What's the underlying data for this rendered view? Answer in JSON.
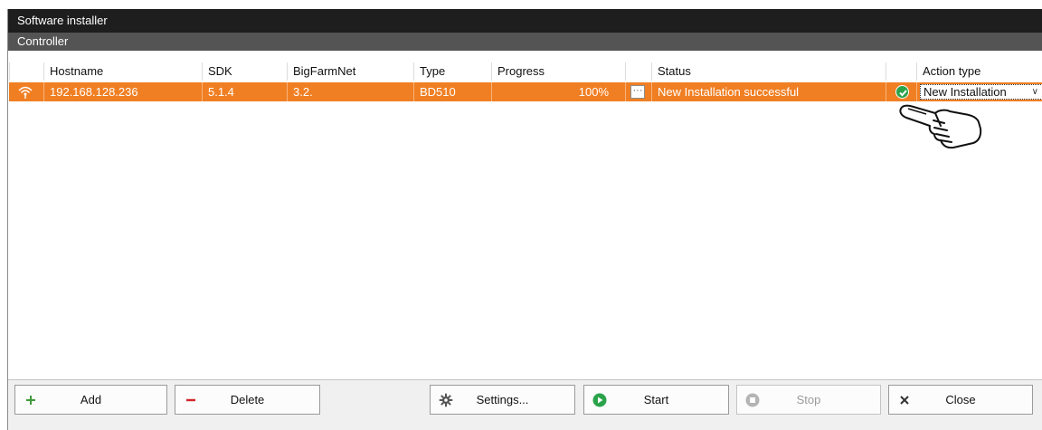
{
  "window": {
    "title": "Software installer"
  },
  "group": {
    "title": "Controller"
  },
  "columns": {
    "hostname": "Hostname",
    "sdk": "SDK",
    "bigfarmnet": "BigFarmNet",
    "type": "Type",
    "progress": "Progress",
    "status": "Status",
    "action_type": "Action type"
  },
  "rows": [
    {
      "hostname": "192.168.128.236",
      "sdk": "5.1.4",
      "bigfarmnet": "3.2.",
      "type": "BD510",
      "progress": "100%",
      "details_button": "···",
      "status": "New Installation successful",
      "action_type": "New Installation",
      "connection_icon": "wifi-icon",
      "status_icon": "check-circle-icon"
    }
  ],
  "buttons": {
    "add": "Add",
    "delete": "Delete",
    "settings": "Settings...",
    "start": "Start",
    "stop": "Stop",
    "close": "Close"
  },
  "colors": {
    "selected_row": "#f07f23",
    "titlebar": "#1e1e1e",
    "groupbar": "#545454",
    "add_icon": "#3d9a3a",
    "delete_icon": "#d4252b",
    "start_icon": "#2aa34a"
  }
}
